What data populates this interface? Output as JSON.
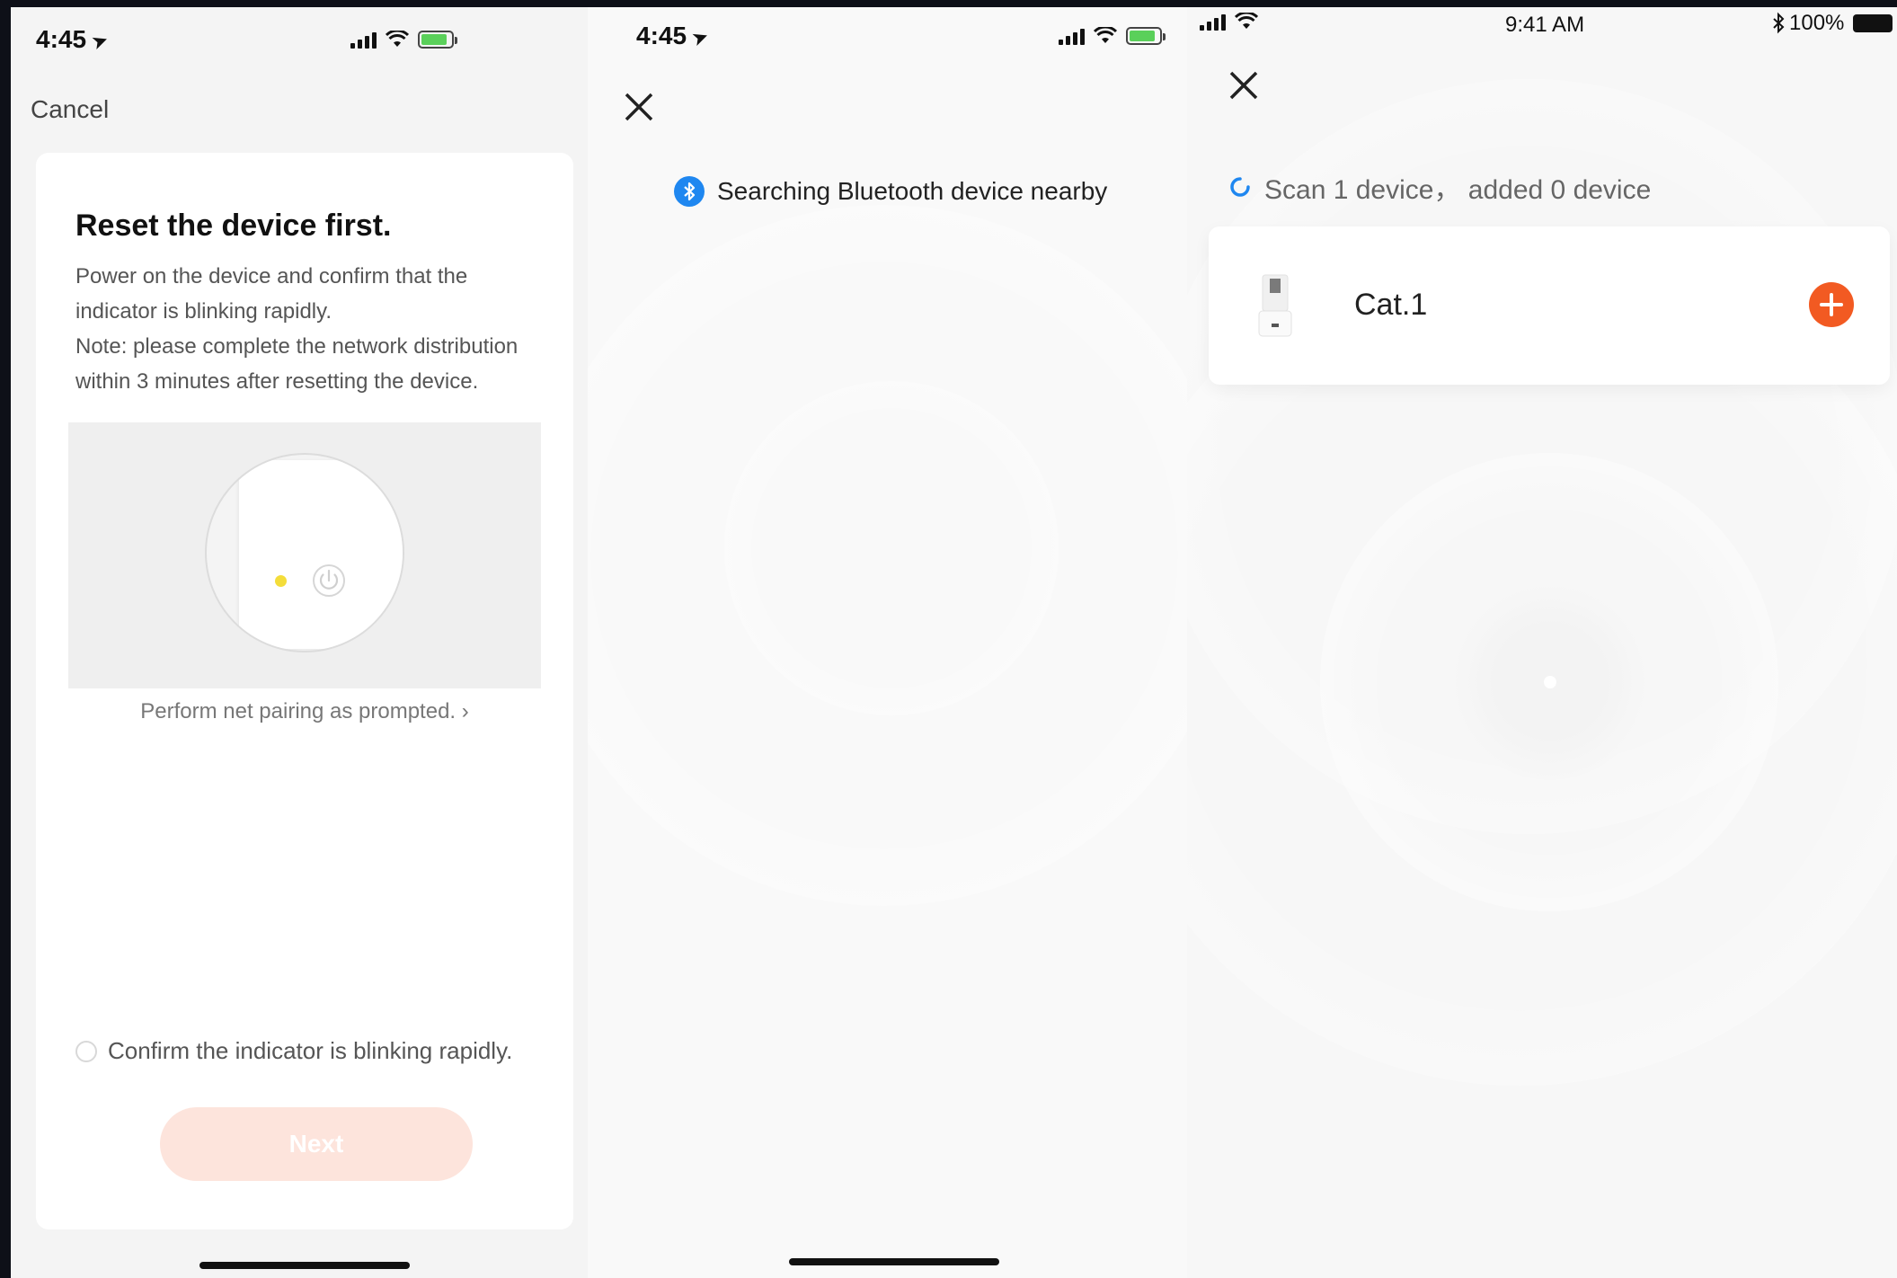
{
  "panel1": {
    "status": {
      "time": "4:45"
    },
    "cancel_label": "Cancel",
    "card": {
      "title": "Reset the device first.",
      "body_lines": [
        "Power on the device and confirm that the",
        "indicator is blinking rapidly.",
        "Note: please complete the network distribution",
        "within 3 minutes after resetting the device."
      ],
      "prompt_link": "Perform net pairing as prompted. ›",
      "confirm_label": "Confirm the indicator is blinking rapidly.",
      "confirm_checked": false,
      "next_label": "Next"
    }
  },
  "panel2": {
    "status": {
      "time": "4:45"
    },
    "search_text": "Searching Bluetooth device nearby"
  },
  "panel3": {
    "status": {
      "time": "9:41 AM",
      "battery": "100%"
    },
    "scan_text": "Scan 1 device， added 0 device",
    "device": {
      "name": "Cat.1"
    }
  },
  "colors": {
    "accent_orange": "#f25a22",
    "next_disabled": "#fde4dc",
    "bluetooth_blue": "#1f87f0",
    "indicator_led": "#f4dd3a"
  }
}
